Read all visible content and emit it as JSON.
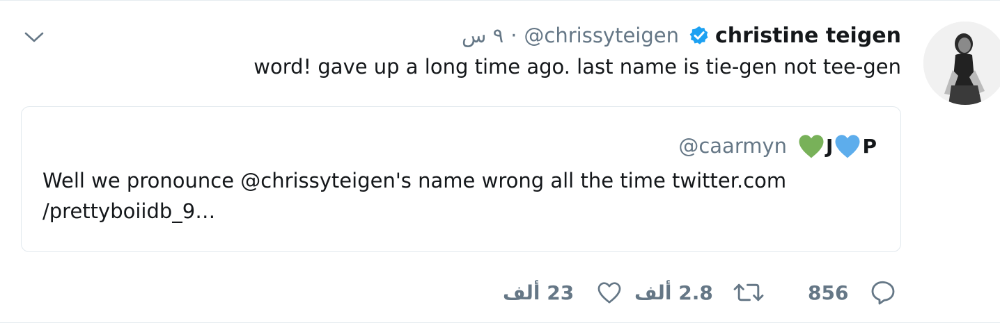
{
  "tweet": {
    "author_name": "christine teigen",
    "author_handle": "@chrissyteigen",
    "separator": "·",
    "time": "٩ س",
    "text": "word! gave up a long time ago. last name is tie-gen not tee-gen"
  },
  "quoted": {
    "name_j": "J",
    "name_p": "P",
    "handle": "@caarmyn",
    "text_line1": "Well we pronounce @chrissyteigen's name wrong all the time twitter.com",
    "text_line2": "/prettyboiidb_9…"
  },
  "actions": {
    "replies": "856",
    "retweets": "2.8 ألف",
    "likes": "23 ألف"
  },
  "colors": {
    "verified": "#1da1f2",
    "secondary_text": "#657786",
    "primary_text": "#14171a",
    "green_heart": "#78b159",
    "blue_heart": "#5dadec"
  },
  "icons": {
    "menu": "chevron-down-icon",
    "verified": "verified-badge-icon",
    "reply": "reply-icon",
    "retweet": "retweet-icon",
    "like": "heart-icon"
  }
}
